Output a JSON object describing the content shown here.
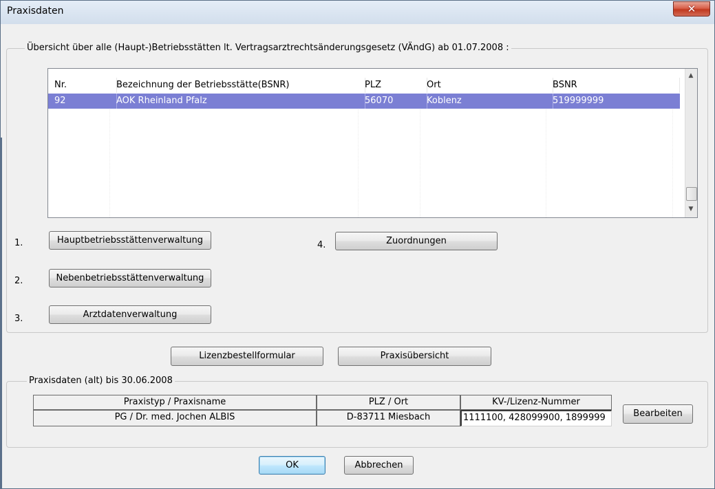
{
  "window": {
    "title": "Praxisdaten",
    "close_glyph": "✕"
  },
  "overview": {
    "legend": "Übersicht über alle (Haupt-)Betriebsstätten lt. Vertragsarztrechtsänderungsgesetz (VÄndG) ab 01.07.2008 :",
    "columns": [
      "Nr.",
      "Bezeichnung der Betriebsstätte(BSNR)",
      "PLZ",
      "Ort",
      "BSNR"
    ],
    "rows": [
      {
        "nr": "92",
        "name": "AOK Rheinland Pfalz",
        "plz": "56070",
        "ort": "Koblenz",
        "bsnr": "519999999"
      }
    ],
    "scroll_up": "▲",
    "scroll_down": "▼"
  },
  "actions": [
    {
      "num": "1.",
      "label": "Hauptbetriebsstättenverwaltung"
    },
    {
      "num": "2.",
      "label": "Nebenbetriebsstättenverwaltung"
    },
    {
      "num": "3.",
      "label": "Arztdatenverwaltung"
    },
    {
      "num": "4.",
      "label": "Zuordnungen"
    }
  ],
  "middle_buttons": {
    "license_form": "Lizenzbestellformular",
    "practice_overview": "Praxisübersicht"
  },
  "old_data": {
    "legend": "Praxisdaten (alt) bis 30.06.2008",
    "headers": [
      "Praxistyp / Praxisname",
      "PLZ / Ort",
      "KV-/Lizenz-Nummer"
    ],
    "values": [
      "PG  / Dr. med. Jochen ALBIS",
      "D-83711 Miesbach",
      "1111100, 428099900, 1899999"
    ],
    "edit_button": "Bearbeiten"
  },
  "footer": {
    "ok": "OK",
    "cancel": "Abbrechen"
  }
}
